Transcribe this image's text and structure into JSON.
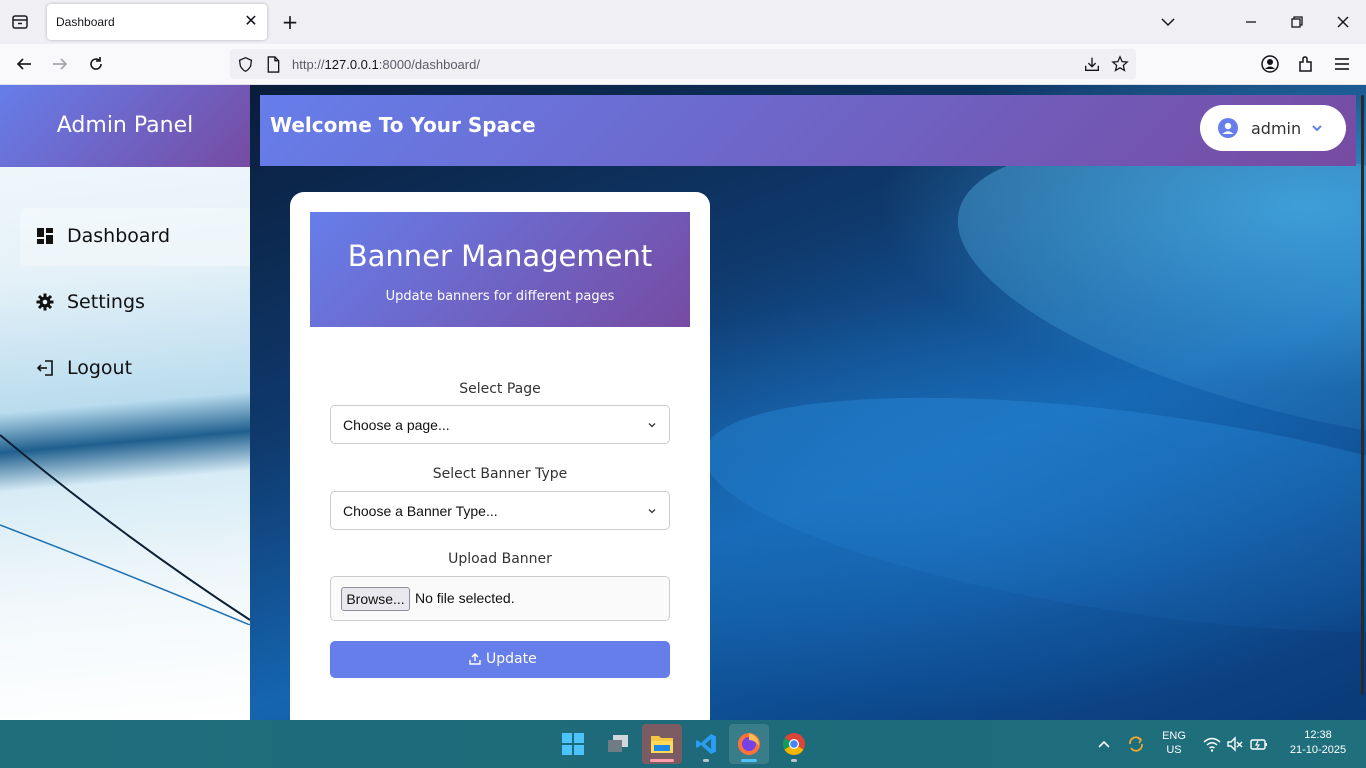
{
  "browser": {
    "tab_title": "Dashboard",
    "url_prefix": "http://",
    "url_host": "127.0.0.1",
    "url_rest": ":8000/dashboard/"
  },
  "sidebar": {
    "title": "Admin Panel",
    "items": [
      {
        "label": "Dashboard",
        "icon": "dashboard-grid-icon",
        "active": true
      },
      {
        "label": "Settings",
        "icon": "gear-icon",
        "active": false
      },
      {
        "label": "Logout",
        "icon": "logout-icon",
        "active": false
      }
    ]
  },
  "topbar": {
    "welcome": "Welcome To Your Space",
    "user": "admin"
  },
  "card": {
    "title": "Banner Management",
    "subtitle": "Update banners for different pages",
    "page_label": "Select Page",
    "page_value": "Choose a page...",
    "type_label": "Select Banner Type",
    "type_value": "Choose a Banner Type...",
    "upload_label": "Upload Banner",
    "browse_label": "Browse...",
    "file_status": "No file selected.",
    "update_label": "Update"
  },
  "taskbar": {
    "lang_top": "ENG",
    "lang_bottom": "US",
    "time": "12:38",
    "date": "21-10-2025"
  },
  "colors": {
    "accent_start": "#667eea",
    "accent_end": "#764ba2",
    "button": "#667eea"
  }
}
